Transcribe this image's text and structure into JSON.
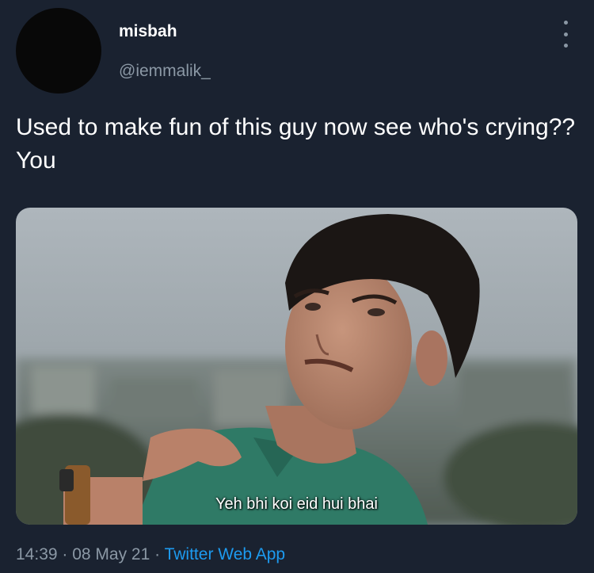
{
  "user": {
    "display_name": "misbah",
    "handle": "@iemmalik_"
  },
  "tweet": {
    "text": "Used to make fun of this guy now see who's crying?? You",
    "media": {
      "caption": "Yeh bhi koi eid hui bhai"
    },
    "time": "14:39",
    "date": "08 May 21",
    "source": "Twitter Web App",
    "separator": " · "
  },
  "icons": {
    "more": "more-vertical-icon"
  }
}
